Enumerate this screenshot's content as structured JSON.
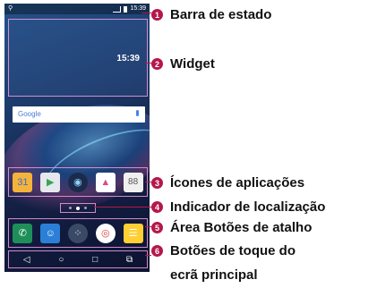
{
  "status_bar": {
    "time": "15:39",
    "left_icon": "notification-icon"
  },
  "widget": {
    "time": "15:39"
  },
  "search_bar": {
    "logo": "Google",
    "mic_icon": "mic-icon"
  },
  "app_icons": [
    {
      "name": "calendar-icon",
      "glyph": "31"
    },
    {
      "name": "play-store-icon",
      "glyph": "▶"
    },
    {
      "name": "camera-icon",
      "glyph": "◉"
    },
    {
      "name": "gallery-icon",
      "glyph": "▲"
    },
    {
      "name": "settings-grid-icon",
      "glyph": "88"
    }
  ],
  "dock": [
    {
      "name": "phone-icon",
      "glyph": "✆"
    },
    {
      "name": "contacts-icon",
      "glyph": "☺"
    },
    {
      "name": "apps-drawer-icon",
      "glyph": "⁘"
    },
    {
      "name": "chrome-icon",
      "glyph": "◎"
    },
    {
      "name": "messages-icon",
      "glyph": "☰"
    }
  ],
  "nav_buttons": [
    "◁",
    "○",
    "□",
    "⧉"
  ],
  "labels": {
    "l1": {
      "num": "1",
      "text": "Barra de estado"
    },
    "l2": {
      "num": "2",
      "text": "Widget"
    },
    "l3": {
      "num": "3",
      "text": "Ícones de aplicações"
    },
    "l4": {
      "num": "4",
      "text": "Indicador de localização"
    },
    "l5": {
      "num": "5",
      "text": "Área Botões de atalho"
    },
    "l6": {
      "num": "6",
      "text": "Botões de toque do"
    },
    "l6_line2": "ecrã principal"
  },
  "colors": {
    "badge": "#b5174a",
    "highlight": "#e696dc"
  }
}
